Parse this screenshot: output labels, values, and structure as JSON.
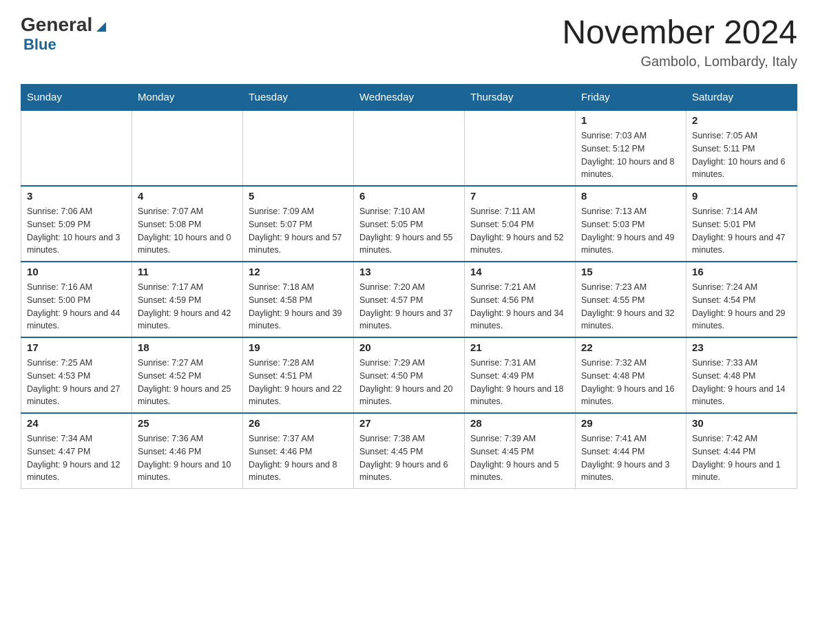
{
  "logo": {
    "general": "General",
    "blue": "Blue",
    "triangle": "▲"
  },
  "header": {
    "month": "November 2024",
    "location": "Gambolo, Lombardy, Italy"
  },
  "days_of_week": [
    "Sunday",
    "Monday",
    "Tuesday",
    "Wednesday",
    "Thursday",
    "Friday",
    "Saturday"
  ],
  "weeks": [
    [
      {
        "day": "",
        "info": ""
      },
      {
        "day": "",
        "info": ""
      },
      {
        "day": "",
        "info": ""
      },
      {
        "day": "",
        "info": ""
      },
      {
        "day": "",
        "info": ""
      },
      {
        "day": "1",
        "info": "Sunrise: 7:03 AM\nSunset: 5:12 PM\nDaylight: 10 hours and 8 minutes."
      },
      {
        "day": "2",
        "info": "Sunrise: 7:05 AM\nSunset: 5:11 PM\nDaylight: 10 hours and 6 minutes."
      }
    ],
    [
      {
        "day": "3",
        "info": "Sunrise: 7:06 AM\nSunset: 5:09 PM\nDaylight: 10 hours and 3 minutes."
      },
      {
        "day": "4",
        "info": "Sunrise: 7:07 AM\nSunset: 5:08 PM\nDaylight: 10 hours and 0 minutes."
      },
      {
        "day": "5",
        "info": "Sunrise: 7:09 AM\nSunset: 5:07 PM\nDaylight: 9 hours and 57 minutes."
      },
      {
        "day": "6",
        "info": "Sunrise: 7:10 AM\nSunset: 5:05 PM\nDaylight: 9 hours and 55 minutes."
      },
      {
        "day": "7",
        "info": "Sunrise: 7:11 AM\nSunset: 5:04 PM\nDaylight: 9 hours and 52 minutes."
      },
      {
        "day": "8",
        "info": "Sunrise: 7:13 AM\nSunset: 5:03 PM\nDaylight: 9 hours and 49 minutes."
      },
      {
        "day": "9",
        "info": "Sunrise: 7:14 AM\nSunset: 5:01 PM\nDaylight: 9 hours and 47 minutes."
      }
    ],
    [
      {
        "day": "10",
        "info": "Sunrise: 7:16 AM\nSunset: 5:00 PM\nDaylight: 9 hours and 44 minutes."
      },
      {
        "day": "11",
        "info": "Sunrise: 7:17 AM\nSunset: 4:59 PM\nDaylight: 9 hours and 42 minutes."
      },
      {
        "day": "12",
        "info": "Sunrise: 7:18 AM\nSunset: 4:58 PM\nDaylight: 9 hours and 39 minutes."
      },
      {
        "day": "13",
        "info": "Sunrise: 7:20 AM\nSunset: 4:57 PM\nDaylight: 9 hours and 37 minutes."
      },
      {
        "day": "14",
        "info": "Sunrise: 7:21 AM\nSunset: 4:56 PM\nDaylight: 9 hours and 34 minutes."
      },
      {
        "day": "15",
        "info": "Sunrise: 7:23 AM\nSunset: 4:55 PM\nDaylight: 9 hours and 32 minutes."
      },
      {
        "day": "16",
        "info": "Sunrise: 7:24 AM\nSunset: 4:54 PM\nDaylight: 9 hours and 29 minutes."
      }
    ],
    [
      {
        "day": "17",
        "info": "Sunrise: 7:25 AM\nSunset: 4:53 PM\nDaylight: 9 hours and 27 minutes."
      },
      {
        "day": "18",
        "info": "Sunrise: 7:27 AM\nSunset: 4:52 PM\nDaylight: 9 hours and 25 minutes."
      },
      {
        "day": "19",
        "info": "Sunrise: 7:28 AM\nSunset: 4:51 PM\nDaylight: 9 hours and 22 minutes."
      },
      {
        "day": "20",
        "info": "Sunrise: 7:29 AM\nSunset: 4:50 PM\nDaylight: 9 hours and 20 minutes."
      },
      {
        "day": "21",
        "info": "Sunrise: 7:31 AM\nSunset: 4:49 PM\nDaylight: 9 hours and 18 minutes."
      },
      {
        "day": "22",
        "info": "Sunrise: 7:32 AM\nSunset: 4:48 PM\nDaylight: 9 hours and 16 minutes."
      },
      {
        "day": "23",
        "info": "Sunrise: 7:33 AM\nSunset: 4:48 PM\nDaylight: 9 hours and 14 minutes."
      }
    ],
    [
      {
        "day": "24",
        "info": "Sunrise: 7:34 AM\nSunset: 4:47 PM\nDaylight: 9 hours and 12 minutes."
      },
      {
        "day": "25",
        "info": "Sunrise: 7:36 AM\nSunset: 4:46 PM\nDaylight: 9 hours and 10 minutes."
      },
      {
        "day": "26",
        "info": "Sunrise: 7:37 AM\nSunset: 4:46 PM\nDaylight: 9 hours and 8 minutes."
      },
      {
        "day": "27",
        "info": "Sunrise: 7:38 AM\nSunset: 4:45 PM\nDaylight: 9 hours and 6 minutes."
      },
      {
        "day": "28",
        "info": "Sunrise: 7:39 AM\nSunset: 4:45 PM\nDaylight: 9 hours and 5 minutes."
      },
      {
        "day": "29",
        "info": "Sunrise: 7:41 AM\nSunset: 4:44 PM\nDaylight: 9 hours and 3 minutes."
      },
      {
        "day": "30",
        "info": "Sunrise: 7:42 AM\nSunset: 4:44 PM\nDaylight: 9 hours and 1 minute."
      }
    ]
  ]
}
